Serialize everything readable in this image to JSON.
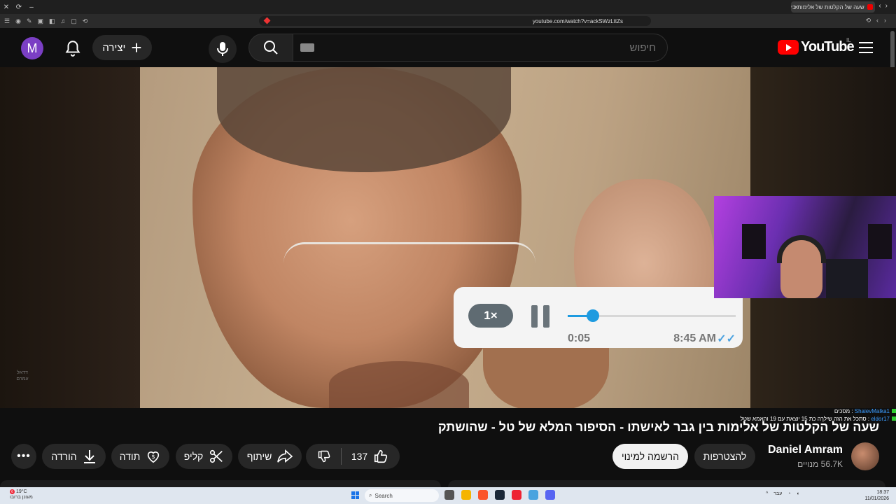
{
  "browser": {
    "tab_title": "שעה של הקלטות של אלימות בי",
    "url": "youtube.com/watch?v=ackSWzLttZs"
  },
  "header": {
    "avatar_letter": "M",
    "create_label": "יצירה",
    "search_placeholder": "חיפוש",
    "logo_text": "YouTube",
    "country_code": "IL"
  },
  "video_overlay": {
    "speed": "1×",
    "elapsed": "0:05",
    "clock": "8:45 AM",
    "progress_fraction": 0.15,
    "watermark": "דדאל עמרם"
  },
  "chat": [
    {
      "user": "ShaievMalka1",
      "text": "מסכים"
    },
    {
      "user": "eldor17",
      "text": "סתכל את הזה שילךה כת 15 יוצאת עם 19 והאמא שטל"
    }
  ],
  "video": {
    "title": "שעה של הקלטות של אלימות בין גבר לאישתו - הסיפור המלא של טל - שהושתק",
    "channel_name": "Daniel Amram",
    "subscribers": "56.7K מנויים",
    "join_label": "להצטרפות",
    "subscribe_label": "הרשמה למינוי",
    "like_count": "137",
    "share_label": "שיתוף",
    "clip_label": "קליפ",
    "thanks_label": "תודה",
    "download_label": "הורדה",
    "more_label": "•••"
  },
  "taskbar": {
    "weather_temp": "19°C",
    "weather_desc": "מעונן ברובו",
    "search_label": "Search",
    "time": "18:37",
    "date": "11/01/2026",
    "lang": "עבר"
  },
  "colors": {
    "yt_red": "#ff0000",
    "accent_blue": "#1e9be0",
    "avatar_purple": "#7b3fc4"
  }
}
